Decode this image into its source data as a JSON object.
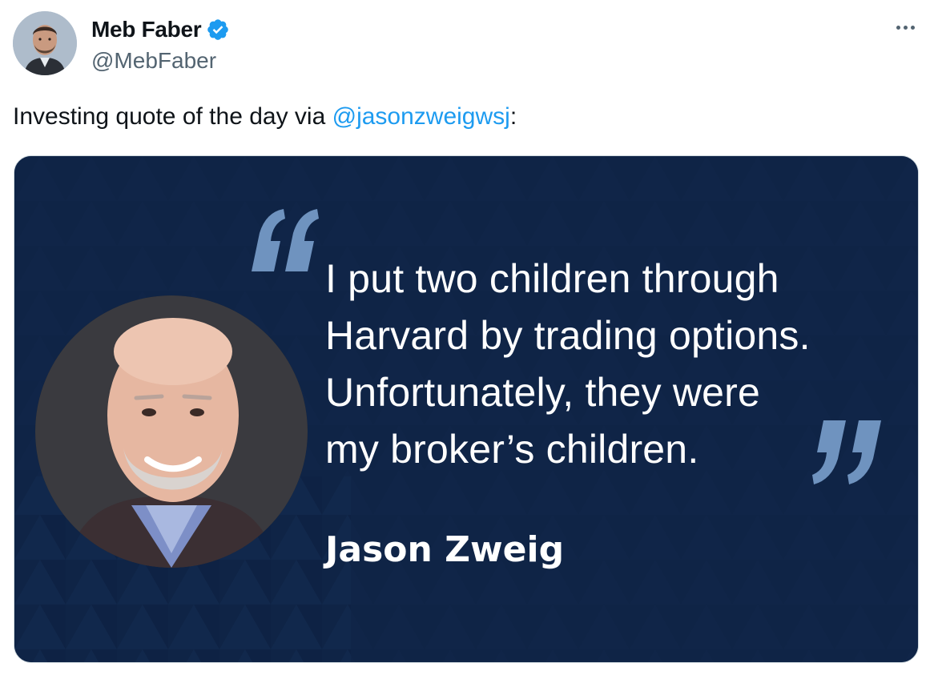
{
  "author": {
    "name": "Meb Faber",
    "handle": "@MebFaber",
    "verified_icon": "verified-badge-icon",
    "verified_color": "#1d9bf0"
  },
  "more_icon": "more-options-icon",
  "tweet": {
    "text_before": "Investing quote of the day via ",
    "mention": "@jasonzweigwsj",
    "text_after": ":"
  },
  "media": {
    "quote_lines": [
      "I put two children through",
      "Harvard by trading options.",
      "Unfortunately, they were",
      "my broker’s children."
    ],
    "attribution": "Jason Zweig",
    "background_color": "#0f2446",
    "quote_mark_color": "#6f93bf"
  }
}
